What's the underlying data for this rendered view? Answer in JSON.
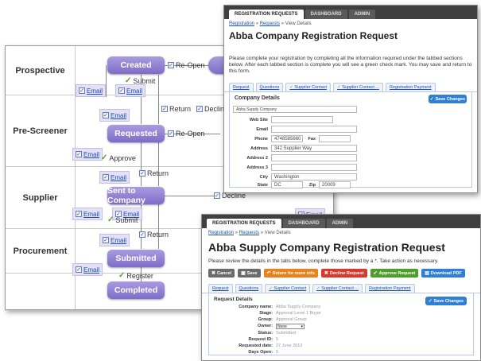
{
  "flow": {
    "lanes": [
      "Prospective",
      "Pre-Screener",
      "Supplier",
      "Procurement"
    ],
    "nodes": {
      "created": "Created",
      "requested": "Requested",
      "sent": "Sent to Company",
      "submitted": "Submitted",
      "completed": "Completed"
    },
    "email_label": "Email",
    "edges": {
      "reopen": "Re-Open",
      "submit": "Submit",
      "return": "Return",
      "decline": "Decline",
      "approve": "Approve",
      "register": "Register"
    }
  },
  "win1": {
    "topnav": [
      "REGISTRATION REQUESTS",
      "DASHBOARD",
      "ADMIN"
    ],
    "crumbs": [
      "Registration",
      "Requests",
      "View Details"
    ],
    "crumb_sep": "»",
    "title": "Abba Company Registration Request",
    "desc": "Please complete your registration by completing all the information required under the tabbed sections below. After each tabbed section is complete you will see a green check mark. You may save and return to this form.",
    "tabs": [
      "Request",
      "Questions",
      "Supplier Contact",
      "Supplier Contact ...",
      "Registration Payment"
    ],
    "section": "Company Details",
    "save": "Save Changes",
    "company_name": "Abba Supply Company",
    "fields": {
      "website": "Web Site",
      "email": "Email",
      "phone": "Phone",
      "phone_val": "4748585660",
      "fax": "Fax",
      "address": "Address",
      "address_val": "342 Supplier Way",
      "address2": "Address 2",
      "address3": "Address 3",
      "city": "City",
      "city_val": "Washington",
      "state": "State",
      "state_val": "DC",
      "zip": "Zip",
      "zip_val": "20009"
    }
  },
  "win2": {
    "topnav": [
      "REGISTRATION REQUESTS",
      "DASHBOARD",
      "ADMIN"
    ],
    "crumbs": [
      "Registration",
      "Requests",
      "View Details"
    ],
    "crumb_sep": "»",
    "title": "Abba Supply Company Registration Request",
    "desc": "Please review the details in the tabs below, complete those marked by a *. Take action as necessary.",
    "actions": [
      "Cancel",
      "Save",
      "Return for more info",
      "Decline Request",
      "Approve Request",
      "Download PDF"
    ],
    "tabs": [
      "Request",
      "Questions",
      "Supplier Contact",
      "Supplier Contact ...",
      "Registration Payment"
    ],
    "section": "Request Details",
    "save": "Save Changes",
    "details": [
      {
        "label": "Company name:",
        "value": "Abba Supply Company"
      },
      {
        "label": "Stage:",
        "value": "Approval Level 1 Buyer"
      },
      {
        "label": "Group:",
        "value": "Approval Group"
      },
      {
        "label": "Owner:",
        "value": "None"
      },
      {
        "label": "Status:",
        "value": "Submitted"
      },
      {
        "label": "Request ID:",
        "value": "5"
      },
      {
        "label": "Requested date:",
        "value": "27 June 2013"
      },
      {
        "label": "Days Open:",
        "value": "5"
      }
    ]
  },
  "colors": {
    "node": "#8f80d2",
    "email_box": "#e4e0f5",
    "link": "#1a4fb5",
    "save_blue": "#2f7fd6",
    "check_green": "#5aa02c"
  }
}
